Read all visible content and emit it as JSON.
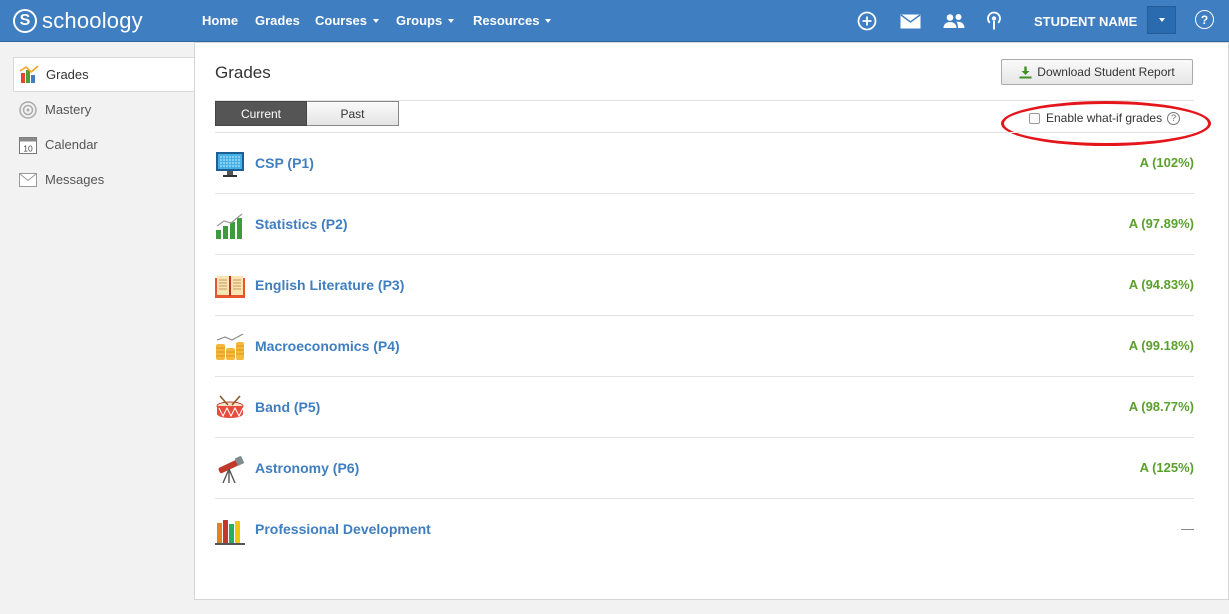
{
  "brand": {
    "logo_letter": "S",
    "name": "schoology"
  },
  "nav": {
    "home": "Home",
    "grades": "Grades",
    "courses": "Courses",
    "groups": "Groups",
    "resources": "Resources",
    "student_name": "STUDENT NAME",
    "help": "?"
  },
  "sidebar": {
    "items": [
      {
        "label": "Grades",
        "icon": "grades-icon",
        "active": true
      },
      {
        "label": "Mastery",
        "icon": "mastery-icon"
      },
      {
        "label": "Calendar",
        "icon": "calendar-icon",
        "icon_text": "10"
      },
      {
        "label": "Messages",
        "icon": "messages-icon"
      }
    ]
  },
  "main": {
    "title": "Grades",
    "download_button": "Download Student Report",
    "tabs": [
      {
        "label": "Current",
        "active": true
      },
      {
        "label": "Past",
        "active": false
      }
    ],
    "whatif_label": "Enable what-if grades",
    "whatif_help": "?",
    "whatif_checked": false
  },
  "courses": [
    {
      "name": "CSP (P1)",
      "grade": "A (102%)",
      "icon": "computer-icon"
    },
    {
      "name": "Statistics (P2)",
      "grade": "A (97.89%)",
      "icon": "bar-chart-icon"
    },
    {
      "name": "English Literature (P3)",
      "grade": "A (94.83%)",
      "icon": "open-book-icon"
    },
    {
      "name": "Macroeconomics (P4)",
      "grade": "A (99.18%)",
      "icon": "coins-icon"
    },
    {
      "name": "Band (P5)",
      "grade": "A (98.77%)",
      "icon": "drum-icon"
    },
    {
      "name": "Astronomy (P6)",
      "grade": "A (125%)",
      "icon": "telescope-icon"
    },
    {
      "name": "Professional Development",
      "grade": "—",
      "icon": "books-icon"
    }
  ],
  "colors": {
    "nav_bg": "#3f7ec1",
    "link": "#3f7ec1",
    "grade": "#5aa02c",
    "annotation": "#e4161b"
  }
}
